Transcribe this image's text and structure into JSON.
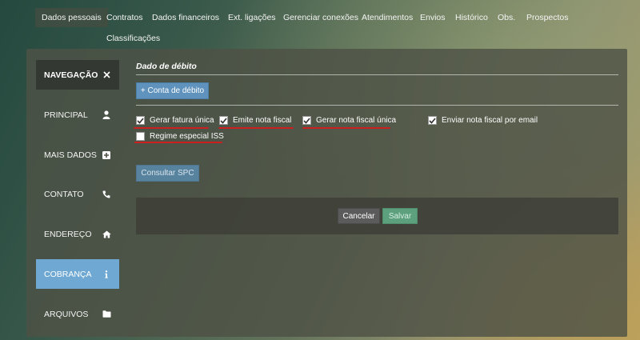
{
  "tabs": [
    {
      "label": "Dados pessoais",
      "active": true
    },
    {
      "label": "Contratos"
    },
    {
      "label": "Dados financeiros"
    },
    {
      "label": "Ext. ligações"
    },
    {
      "label": "Gerenciar conexões"
    },
    {
      "label": "Atendimentos"
    },
    {
      "label": "Envios"
    },
    {
      "label": "Histórico"
    },
    {
      "label": "Obs."
    },
    {
      "label": "Prospectos"
    },
    {
      "label": "Classificações"
    }
  ],
  "sidebar": {
    "header": {
      "label": "NAVEGAÇÃO",
      "icon": "close-icon"
    },
    "items": [
      {
        "label": "PRINCIPAL",
        "icon": "user-icon"
      },
      {
        "label": "MAIS DADOS",
        "icon": "plus-square-icon"
      },
      {
        "label": "CONTATO",
        "icon": "phone-icon"
      },
      {
        "label": "ENDEREÇO",
        "icon": "home-icon"
      },
      {
        "label": "COBRANÇA",
        "icon": "info-icon",
        "active": true
      },
      {
        "label": "ARQUIVOS",
        "icon": "folder-icon"
      }
    ]
  },
  "content": {
    "section_title": "Dado de débito",
    "add_account_button": "+ Conta de débito",
    "checkboxes": [
      {
        "label": "Gerar fatura única",
        "checked": true
      },
      {
        "label": "Emite nota fiscal",
        "checked": true
      },
      {
        "label": "Gerar nota fiscal única",
        "checked": true
      },
      {
        "label": "Enviar nota fiscal por email",
        "checked": true
      },
      {
        "label": "Regime especial ISS",
        "checked": false
      }
    ],
    "spc_button": "Consultar SPC",
    "cancel_button": "Cancelar",
    "save_button": "Salvar"
  },
  "colors": {
    "active_nav": "#6fa8d3",
    "annotation_underline": "#cc1f1f",
    "save_button": "#5da07e"
  }
}
